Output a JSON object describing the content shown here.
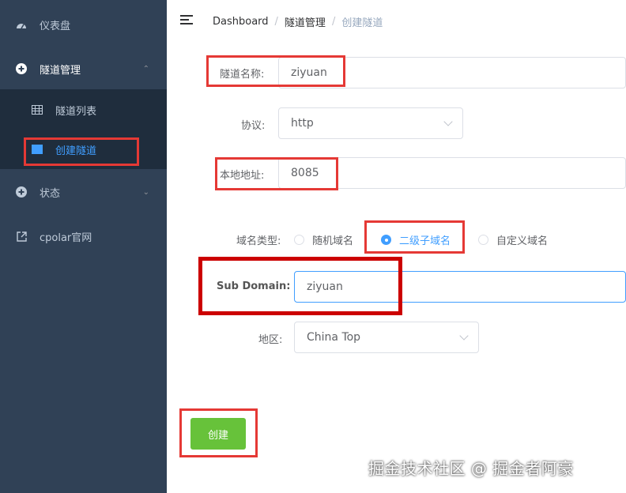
{
  "sidebar": {
    "items": [
      {
        "icon": "dashboard-icon",
        "label": "仪表盘"
      },
      {
        "icon": "plus-circle-icon",
        "label": "隧道管理"
      },
      {
        "icon": "plus-circle-icon",
        "label": "状态"
      },
      {
        "icon": "external-link-icon",
        "label": "cpolar官网"
      }
    ],
    "subitems": [
      {
        "icon": "table-icon",
        "label": "隧道列表"
      },
      {
        "icon": "table-icon",
        "label": "创建隧道"
      }
    ]
  },
  "header": {
    "breadcrumb": [
      "Dashboard",
      "隧道管理",
      "创建隧道"
    ],
    "separator": "/"
  },
  "form": {
    "tunnel_name_label": "隧道名称:",
    "tunnel_name_value": "ziyuan",
    "protocol_label": "协议:",
    "protocol_value": "http",
    "local_addr_label": "本地地址:",
    "local_addr_value": "8085",
    "domain_type_label": "域名类型:",
    "domain_type_options": [
      "随机域名",
      "二级子域名",
      "自定义域名"
    ],
    "domain_type_selected": "二级子域名",
    "subdomain_label": "Sub Domain:",
    "subdomain_value": "ziyuan",
    "region_label": "地区:",
    "region_value": "China Top",
    "create_button": "创建"
  },
  "watermark": "掘金技术社区 @ 掘金者阿豪",
  "colors": {
    "sidebar_bg": "#304156",
    "submenu_bg": "#1f2d3d",
    "accent": "#409eff",
    "create_button": "#67c23a",
    "highlight": "#e53935"
  }
}
